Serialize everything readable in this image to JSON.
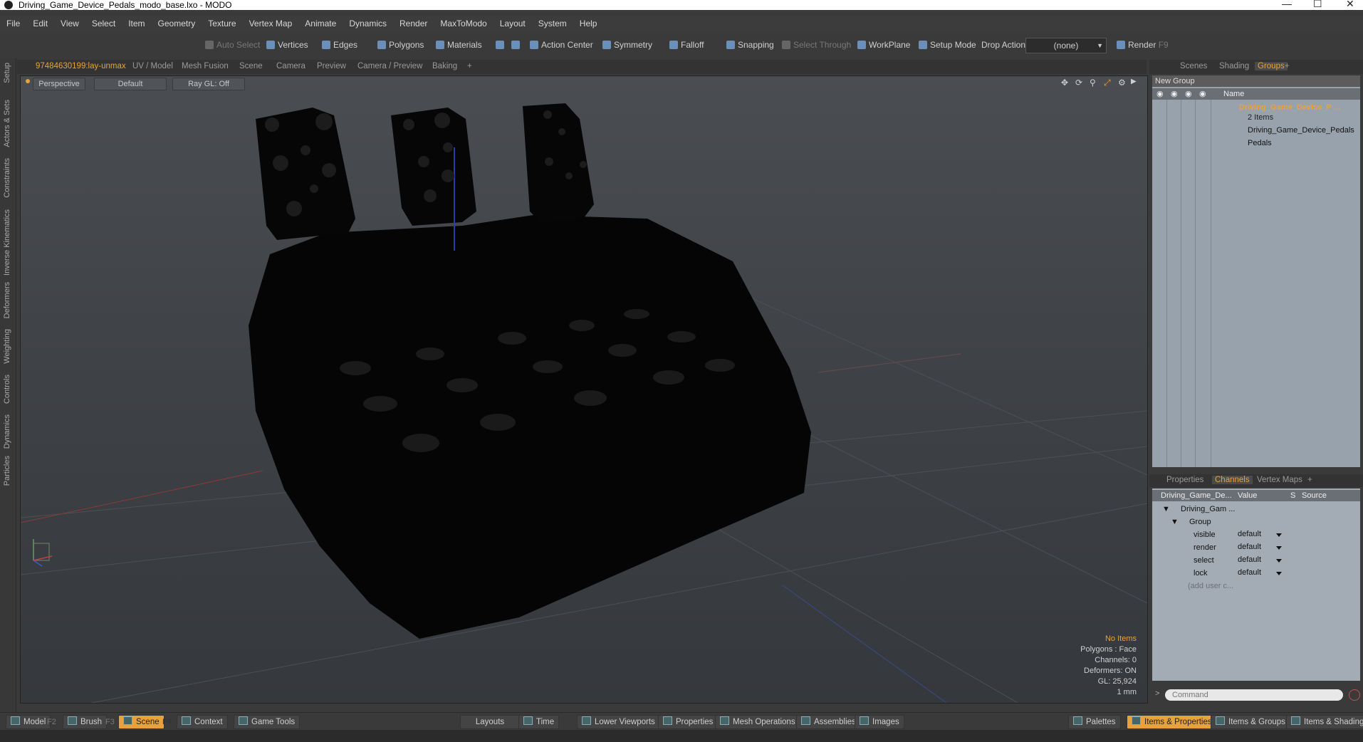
{
  "window": {
    "title": "Driving_Game_Device_Pedals_modo_base.lxo - MODO"
  },
  "menu": [
    "File",
    "Edit",
    "View",
    "Select",
    "Item",
    "Geometry",
    "Texture",
    "Vertex Map",
    "Animate",
    "Dynamics",
    "Render",
    "MaxToModo",
    "Layout",
    "System",
    "Help"
  ],
  "toolbar": {
    "auto_select": "Auto Select",
    "vertices": "Vertices",
    "edges": "Edges",
    "polygons": "Polygons",
    "materials": "Materials",
    "action_center": "Action Center",
    "symmetry": "Symmetry",
    "falloff": "Falloff",
    "snapping": "Snapping",
    "select_through": "Select Through",
    "workplane": "WorkPlane",
    "setup_mode": "Setup Mode",
    "drop_action": "Drop Action",
    "drop_value": "(none)",
    "render": "Render",
    "render_key": "F9"
  },
  "left_tabs": [
    "Setup",
    "Actors & Sets",
    "Constraints",
    "Inverse Kinematics",
    "Deformers",
    "Weighting",
    "Controls",
    "Dynamics",
    "Particles"
  ],
  "viewport_tabs": [
    "97484630199:lay-unmax",
    "UV / Model",
    "Mesh Fusion",
    "Scene",
    "Camera",
    "Preview",
    "Camera / Preview",
    "Baking",
    "+"
  ],
  "viewport": {
    "view": "Perspective",
    "shading": "Default",
    "raygl": "Ray GL: Off",
    "info": [
      "No Items",
      "Polygons : Face",
      "Channels: 0",
      "Deformers: ON",
      "GL: 25,924",
      "1 mm"
    ]
  },
  "right_tabs": [
    "Scenes",
    "Shading",
    "Groups",
    "+"
  ],
  "groups": {
    "new_group": "New Group",
    "name_header": "Name",
    "root": "Driving_Game_Device_P ...",
    "count": "2 Items",
    "children": [
      "Driving_Game_Device_Pedals",
      "Pedals"
    ]
  },
  "channel_tabs": [
    "Properties",
    "Channels",
    "Vertex Maps",
    "+"
  ],
  "channels": {
    "headers": [
      "Driving_Game_De...",
      "Value",
      "S",
      "Source"
    ],
    "item": "Driving_Gam ...",
    "group": "Group",
    "rows": [
      {
        "name": "visible",
        "value": "default"
      },
      {
        "name": "render",
        "value": "default"
      },
      {
        "name": "select",
        "value": "default"
      },
      {
        "name": "lock",
        "value": "default"
      }
    ],
    "add_user": "(add user c..."
  },
  "command_placeholder": "Command",
  "bottom": {
    "model": "Model",
    "model_key": "F2",
    "brush": "Brush",
    "brush_key": "F3",
    "scene": "Scene",
    "scene_key": "F4",
    "context": "Context",
    "game_tools": "Game Tools",
    "layouts": "Layouts",
    "time": "Time",
    "lower_viewports": "Lower Viewports",
    "properties": "Properties",
    "mesh_operations": "Mesh Operations",
    "assemblies": "Assemblies",
    "images": "Images",
    "palettes": "Palettes",
    "items_properties": "Items & Properties",
    "items_groups": "Items & Groups",
    "items_shading": "Items & Shading"
  }
}
